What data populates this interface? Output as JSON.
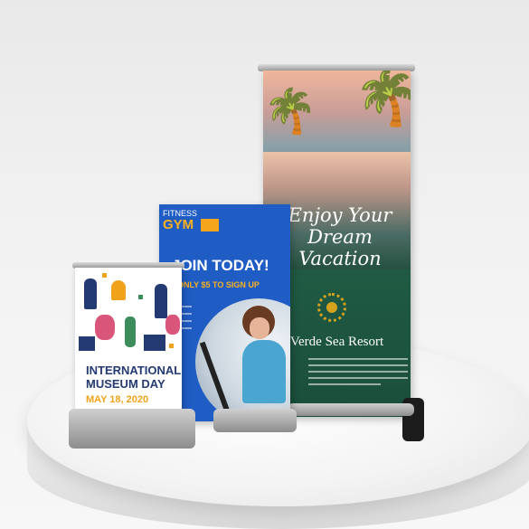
{
  "scene": "three roll-up banners on a white pedestal",
  "banners": {
    "resort": {
      "headline_lines": [
        "Enjoy Your",
        "Dream",
        "Vacation"
      ],
      "name": "Verde Sea Resort"
    },
    "gym": {
      "logo_top": "FITNESS",
      "logo_bottom": "GYM",
      "headline": "JOIN TODAY!",
      "offer": "ONLY $5 TO SIGN UP"
    },
    "museum": {
      "title_lines": [
        "INTERNATIONAL",
        "MUSEUM DAY"
      ],
      "date": "MAY 18, 2020"
    }
  },
  "colors": {
    "resort_green": "#1f5a43",
    "gym_blue": "#1f5cc4",
    "gym_accent": "#ffb11b",
    "museum_navy": "#243a73",
    "museum_accent": "#f0a31a",
    "emblem_gold": "#d4a21c"
  }
}
